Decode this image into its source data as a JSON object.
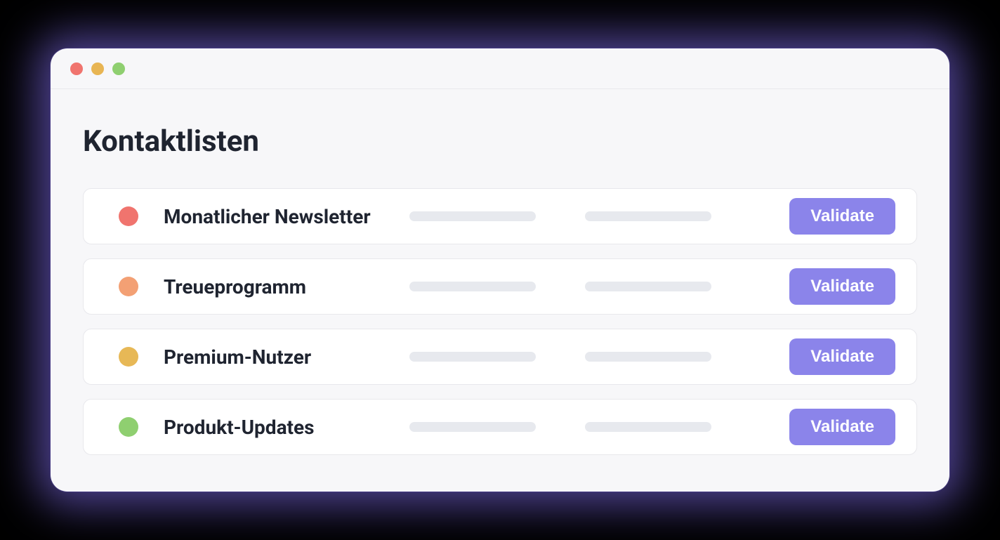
{
  "page": {
    "title": "Kontaktlisten"
  },
  "lists": [
    {
      "label": "Monatlicher Newsletter",
      "color": "c-red",
      "action": "Validate"
    },
    {
      "label": "Treueprogramm",
      "color": "c-orange",
      "action": "Validate"
    },
    {
      "label": "Premium-Nutzer",
      "color": "c-yellow",
      "action": "Validate"
    },
    {
      "label": "Produkt-Updates",
      "color": "c-green",
      "action": "Validate"
    }
  ]
}
